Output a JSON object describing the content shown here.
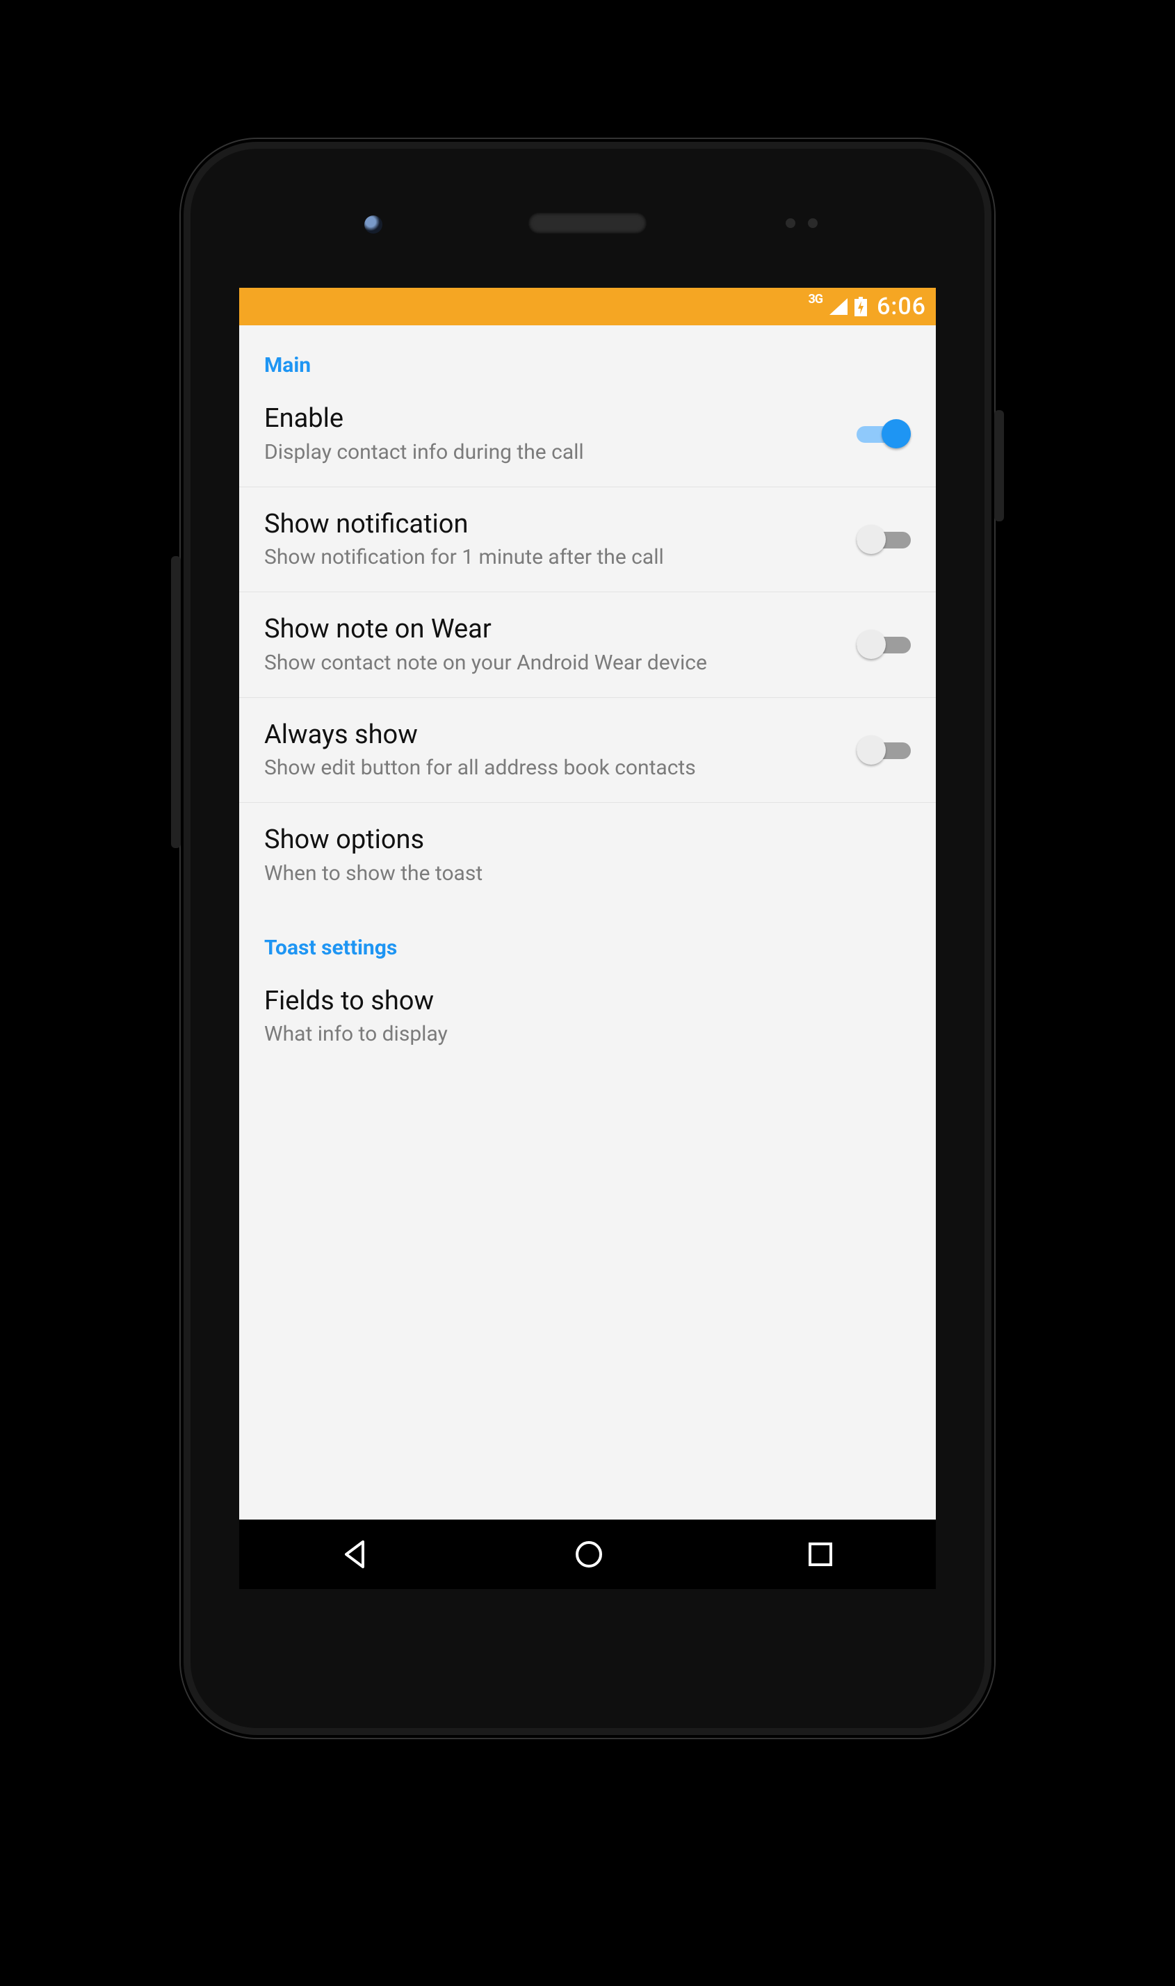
{
  "statusbar": {
    "network_label": "3G",
    "time": "6:06"
  },
  "sections": [
    {
      "header": "Main",
      "items": [
        {
          "title": "Enable",
          "subtitle": "Display contact info during the call",
          "switch": true,
          "on": true
        },
        {
          "title": "Show notification",
          "subtitle": "Show notification for 1 minute after the call",
          "switch": true,
          "on": false
        },
        {
          "title": "Show note on Wear",
          "subtitle": "Show contact note on your Android Wear device",
          "switch": true,
          "on": false
        },
        {
          "title": "Always show",
          "subtitle": "Show edit button for all address book contacts",
          "switch": true,
          "on": false
        },
        {
          "title": "Show options",
          "subtitle": "When to show the toast",
          "switch": false
        }
      ]
    },
    {
      "header": "Toast settings",
      "items": [
        {
          "title": "Fields to show",
          "subtitle": "What info to display",
          "switch": false
        }
      ]
    }
  ]
}
